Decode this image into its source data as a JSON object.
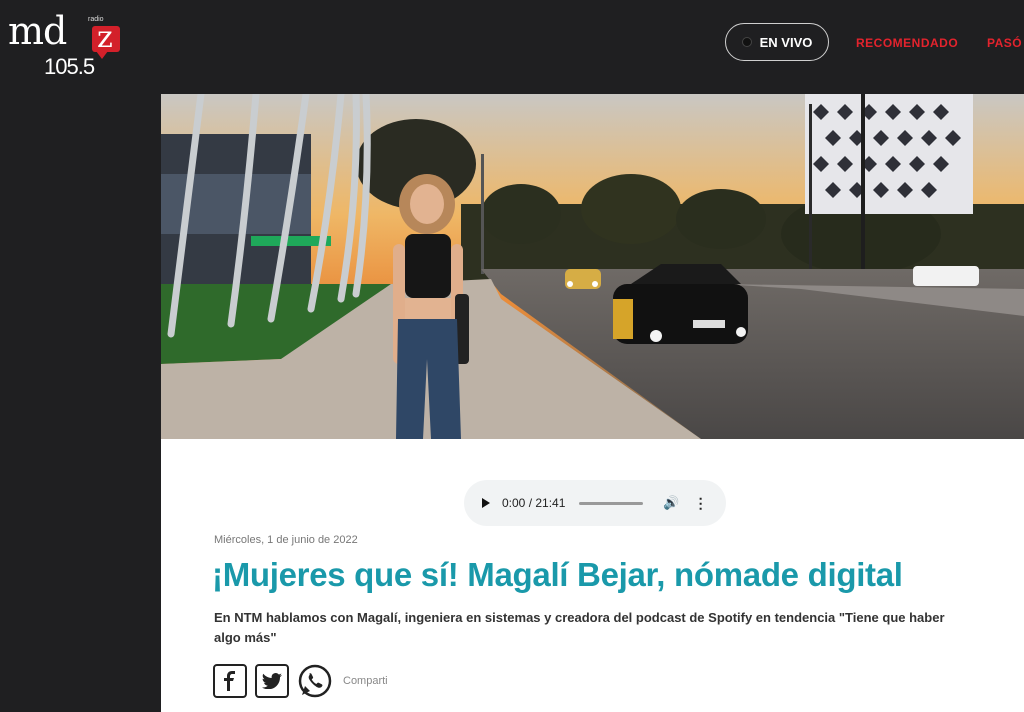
{
  "logo": {
    "radio": "radio",
    "brand": "md",
    "brand_z": "z",
    "frequency": "105.5"
  },
  "header": {
    "live_label": "EN VIVO",
    "nav": [
      "RECOMENDADO",
      "PASÓ"
    ]
  },
  "player": {
    "time": "0:00 / 21:41"
  },
  "article": {
    "date": "Miércoles, 1 de junio de 2022",
    "title": "¡Mujeres que sí! Magalí Bejar, nómade digital",
    "subtitle": "En NTM hablamos con Magalí, ingeniera en sistemas y creadora del podcast de Spotify en tendencia \"Tiene que haber algo más\"",
    "share_label": "Comparti"
  },
  "colors": {
    "accent_title": "#1a99aa",
    "nav_red": "#e3232d",
    "header_bg": "#1f1f21"
  },
  "icons": [
    "facebook-icon",
    "twitter-icon",
    "whatsapp-icon",
    "play-icon",
    "volume-icon",
    "more-icon"
  ]
}
